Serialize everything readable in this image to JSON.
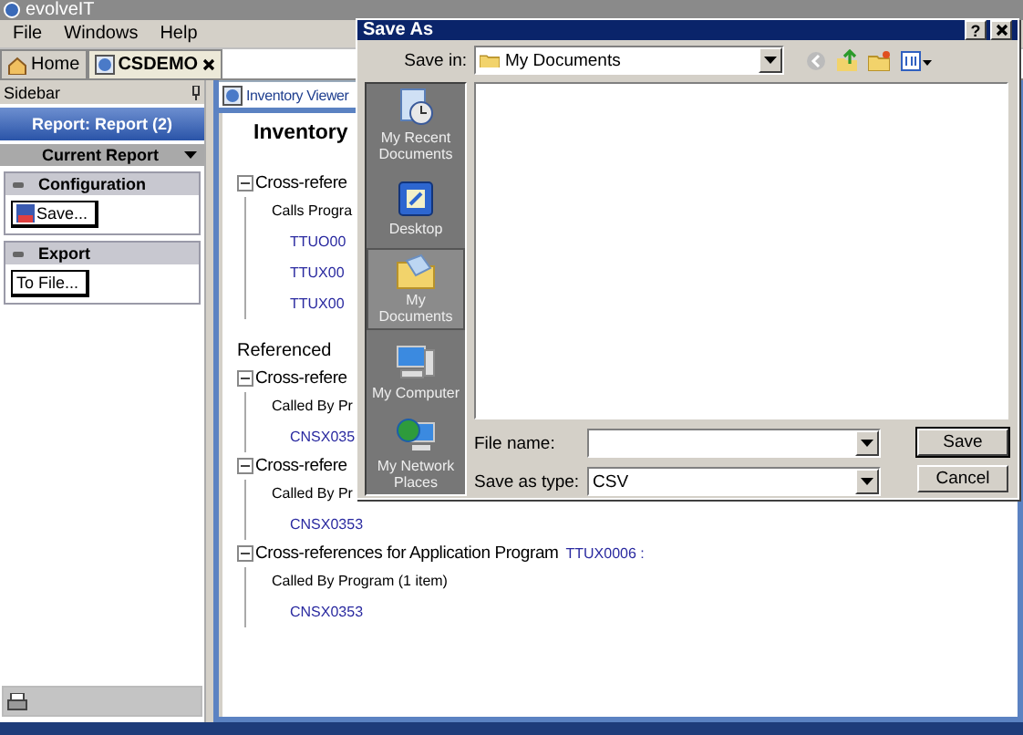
{
  "window": {
    "title": "evolveIT"
  },
  "menu": [
    "File",
    "Windows",
    "Help"
  ],
  "tabs": [
    {
      "label": "Home",
      "selected": false,
      "closable": false
    },
    {
      "label": "CSDEMO",
      "selected": true,
      "closable": true
    }
  ],
  "sidebar": {
    "title": "Sidebar",
    "report": "Report: Report (2)",
    "current": "Current Report",
    "groups": [
      {
        "title": "Configuration",
        "button": "Save...",
        "icon": true
      },
      {
        "title": "Export",
        "button": "To File...",
        "icon": false
      }
    ]
  },
  "viewer": {
    "tab": "Inventory Viewer",
    "title": "Inventory",
    "sections": [
      {
        "kind": "xref",
        "title": "Cross-refere",
        "expanded": true,
        "group": "Calls Progra",
        "links": [
          "TTUO00",
          "TTUX00",
          "TTUX00"
        ]
      },
      {
        "kind": "heading",
        "title": "Referenced"
      },
      {
        "kind": "xref",
        "title": "Cross-refere",
        "expanded": true,
        "group": "Called By Pr",
        "links": [
          "CNSX035"
        ]
      },
      {
        "kind": "xref",
        "title": "Cross-refere",
        "expanded": true,
        "group": "Called By Pr",
        "links": [
          "CNSX0353"
        ]
      },
      {
        "kind": "xref",
        "title": "Cross-references for Application Program",
        "code": "TTUX0006 :",
        "expanded": true,
        "group": "Called By Program (1 item)",
        "links": [
          "CNSX0353"
        ]
      }
    ]
  },
  "dialog": {
    "title": "Save As",
    "help": "?",
    "save_in_label": "Save in:",
    "save_in": "My Documents",
    "places": [
      {
        "label": "My Recent Documents",
        "selected": false
      },
      {
        "label": "Desktop",
        "selected": false
      },
      {
        "label": "My Documents",
        "selected": true
      },
      {
        "label": "My Computer",
        "selected": false
      },
      {
        "label": "My Network Places",
        "selected": false
      }
    ],
    "file_name_label": "File name:",
    "type_label": "Save as type:",
    "type": "CSV",
    "buttons": [
      {
        "label": "Save",
        "default": true
      },
      {
        "label": "Cancel",
        "default": false
      }
    ]
  }
}
